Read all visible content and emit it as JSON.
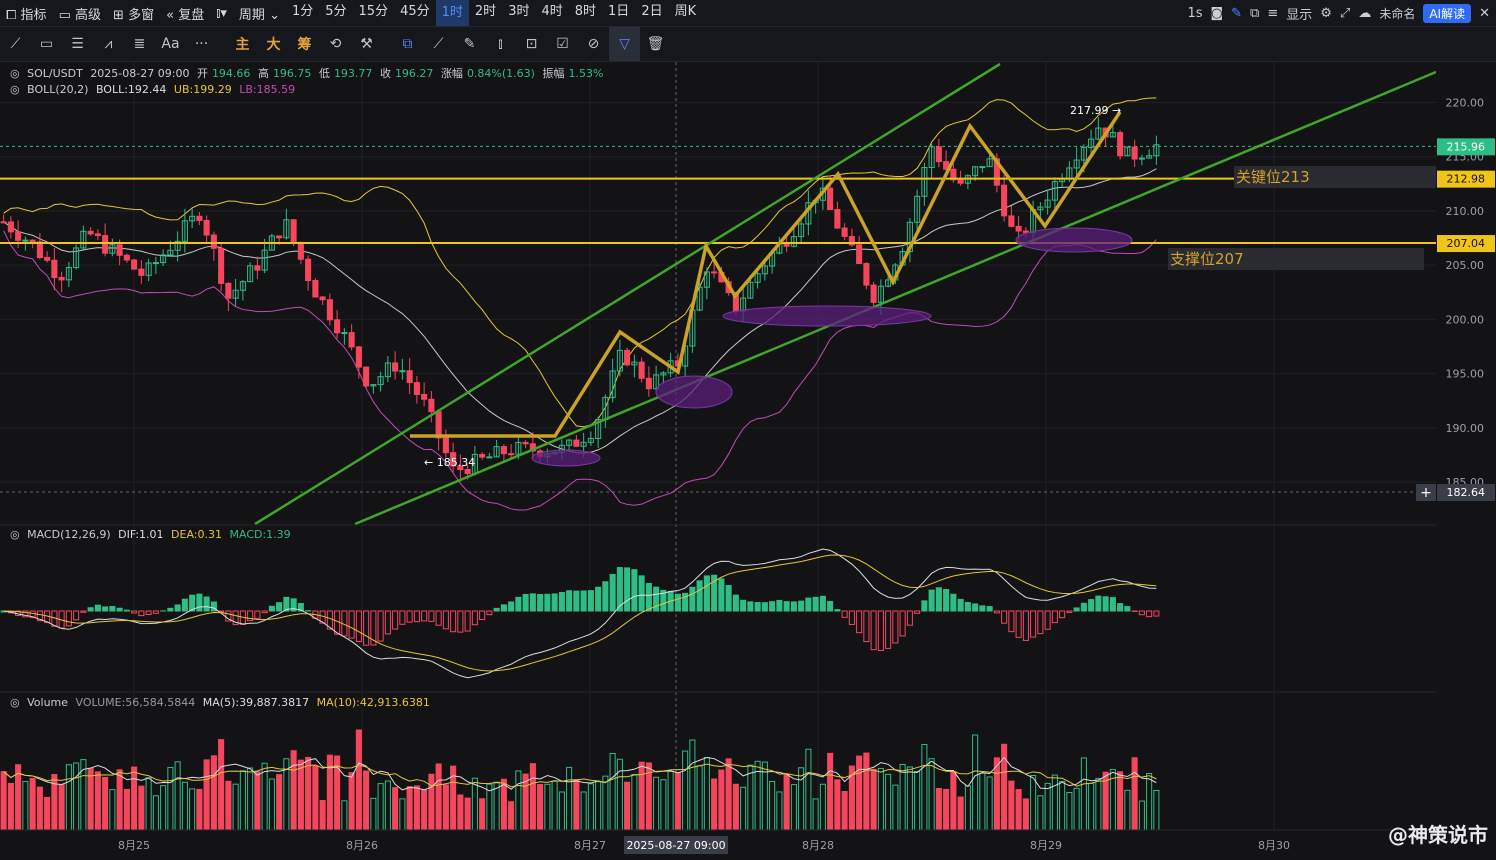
{
  "topbar": {
    "items": [
      {
        "label": "指标",
        "icon": "chart-icon"
      },
      {
        "label": "高级",
        "icon": "window-icon"
      },
      {
        "label": "多窗",
        "icon": "grid-icon"
      },
      {
        "label": "复盘",
        "icon": "rewind-icon"
      },
      {
        "label": "",
        "icon": "candle-icon"
      },
      {
        "label": "周期",
        "icon": "chevron-down-icon"
      }
    ],
    "periods": [
      "1分",
      "5分",
      "15分",
      "45分",
      "1时",
      "2时",
      "3时",
      "4时",
      "8时",
      "1日",
      "2日",
      "周K"
    ],
    "active_period": "1时",
    "right": {
      "interval": "1s",
      "display": "显示",
      "user": "未命名",
      "ai": "AI解读"
    }
  },
  "toolbar": {
    "tools_a": [
      "line-tool-icon",
      "rect-tool-icon",
      "hlines-tool-icon",
      "wave-tool-icon",
      "fib-tool-icon",
      "text-tool-icon",
      "more-tool-icon"
    ],
    "text_tool": "Aa",
    "more": "···",
    "labels": [
      "主",
      "大",
      "筹"
    ],
    "tools_b": [
      "magnet-icon",
      "brush-icon",
      "ruler-icon",
      "pencil-icon",
      "candle-tool-icon",
      "lock-icon",
      "note-icon",
      "measure-icon",
      "filter-icon",
      "trash-icon"
    ]
  },
  "header": {
    "symbol": "SOL/USDT",
    "time": "2025-08-27 09:00",
    "open_label": "开",
    "open": "194.66",
    "high_label": "高",
    "high": "196.75",
    "low_label": "低",
    "low": "193.77",
    "close_label": "收",
    "close": "196.27",
    "chg_label": "涨幅",
    "chg": "0.84%(1.63)",
    "amp_label": "振幅",
    "amp": "1.53%"
  },
  "boll": {
    "name": "BOLL(20,2)",
    "boll": "BOLL:192.44",
    "ub": "UB:199.29",
    "lb": "LB:185.59"
  },
  "macd": {
    "name": "MACD(12,26,9)",
    "dif": "DIF:1.01",
    "dea": "DEA:0.31",
    "macd": "MACD:1.39"
  },
  "volume": {
    "name": "Volume",
    "vol": "VOLUME:56,584.5844",
    "ma5": "MA(5):39,887.3817",
    "ma10": "MA(10):42,913.6381"
  },
  "annotations": {
    "key_level": "关键位213",
    "support": "支撑位207",
    "high_mark": "217.99",
    "low_mark": "185.34",
    "cross_time": "2025-08-27 09:00",
    "cursor_price": "182.64"
  },
  "price_tags": {
    "last": "215.96",
    "level1": "212.98",
    "level2": "207.04"
  },
  "watermark": "@神策说市",
  "colors": {
    "up": "#2ebd85",
    "down": "#f6465d",
    "gold": "#f0c419",
    "green_line": "#3fa62a",
    "purple": "#5b1f7a",
    "ub": "#e6c53a",
    "lb": "#c44ab8",
    "mid": "#c8c8c8",
    "bg": "#131316"
  },
  "chart_data": {
    "type": "candlestick",
    "symbol": "SOL/USDT",
    "interval": "1h",
    "x_ticks": [
      "8月25",
      "8月26",
      "8月27",
      "8月28",
      "8月29",
      "8月30"
    ],
    "y_ticks": [
      "220.00",
      "215.00",
      "210.00",
      "205.00",
      "200.00",
      "195.00",
      "190.00",
      "185.00"
    ],
    "ylim": [
      181.5,
      223
    ],
    "horizontal_levels": [
      212.98,
      207.04
    ],
    "close_path": [
      {
        "t": "8月25",
        "v": 209
      },
      {
        "t": "8月25",
        "v": 207
      },
      {
        "t": "8月25",
        "v": 204
      },
      {
        "t": "8月25",
        "v": 208
      },
      {
        "t": "8月25",
        "v": 206
      },
      {
        "t": "8月25",
        "v": 204
      },
      {
        "t": "8月25",
        "v": 207
      },
      {
        "t": "8月25",
        "v": 210
      },
      {
        "t": "8月25",
        "v": 202
      },
      {
        "t": "8月25",
        "v": 205
      },
      {
        "t": "8月26",
        "v": 209
      },
      {
        "t": "8月26",
        "v": 203
      },
      {
        "t": "8月26",
        "v": 199
      },
      {
        "t": "8月26",
        "v": 194
      },
      {
        "t": "8月26",
        "v": 196
      },
      {
        "t": "8月26",
        "v": 192
      },
      {
        "t": "8月26",
        "v": 186
      },
      {
        "t": "8月26",
        "v": 187
      },
      {
        "t": "8月26",
        "v": 188
      },
      {
        "t": "8月26",
        "v": 188
      },
      {
        "t": "8月27",
        "v": 188
      },
      {
        "t": "8月27",
        "v": 190
      },
      {
        "t": "8月27",
        "v": 197
      },
      {
        "t": "8月27",
        "v": 194
      },
      {
        "t": "8月27",
        "v": 196
      },
      {
        "t": "8月27",
        "v": 205
      },
      {
        "t": "8月27",
        "v": 201
      },
      {
        "t": "8月27",
        "v": 205
      },
      {
        "t": "8月27",
        "v": 208
      },
      {
        "t": "8月27",
        "v": 212
      },
      {
        "t": "8月28",
        "v": 207
      },
      {
        "t": "8月28",
        "v": 202
      },
      {
        "t": "8月28",
        "v": 207
      },
      {
        "t": "8月28",
        "v": 216
      },
      {
        "t": "8月28",
        "v": 212
      },
      {
        "t": "8月28",
        "v": 215
      },
      {
        "t": "8月28",
        "v": 207
      },
      {
        "t": "8月29",
        "v": 211
      },
      {
        "t": "8月29",
        "v": 215
      },
      {
        "t": "8月29",
        "v": 218
      },
      {
        "t": "8月29",
        "v": 215
      },
      {
        "t": "8月29",
        "v": 216
      }
    ],
    "macd_ylim": [
      -4.5,
      4.5
    ],
    "macd_ticks": [
      "4.00",
      "2.00",
      "0.00",
      "-2.00",
      "-4.00"
    ],
    "volume_ticks": [
      "400.00k",
      "200.00k"
    ]
  }
}
